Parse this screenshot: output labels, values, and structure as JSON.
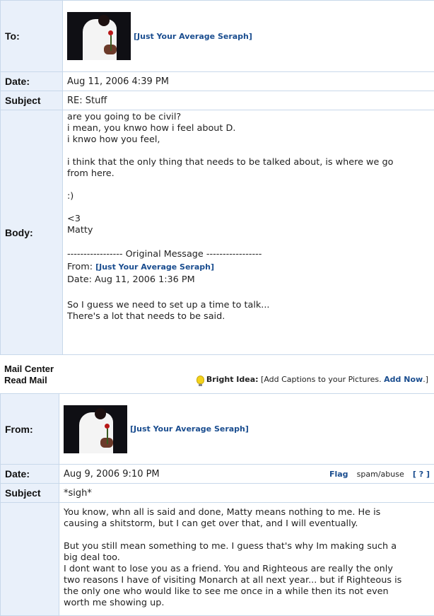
{
  "message1": {
    "to_label": "To:",
    "to_name": "[Just Your Average Seraph]",
    "date_label": "Date:",
    "date_value": "Aug 11, 2006 4:39 PM",
    "subject_label": "Subject",
    "subject_value": "RE: Stuff",
    "body_label": "Body:",
    "body_lines_a": "are you going to be civil?\ni mean, you knwo how i feel about D.\ni knwo how you feel,\n\ni think that the only thing that needs to be talked about, is where we go\nfrom here.\n\n:)\n\n<3\nMatty\n\n",
    "original_header": "----------------- Original Message -----------------",
    "from_prefix": "From: ",
    "from_name": "[Just Your Average Seraph]",
    "orig_date": "Date: Aug 11, 2006 1:36 PM",
    "body_lines_b": "So I guess we need to set up a time to talk...\nThere's a lot that needs to be said."
  },
  "mail_center": {
    "title": "Mail Center",
    "subtitle": "Read Mail",
    "bright_idea_label": "Bright Idea:",
    "bright_idea_text": "[Add Captions to your Pictures.",
    "add_now_label": "Add Now",
    "bright_idea_end": ".]"
  },
  "message2": {
    "from_label": "From:",
    "from_name": "[Just Your Average Seraph]",
    "date_label": "Date:",
    "date_value": "Aug 9, 2006 9:10 PM",
    "flag_label": "Flag",
    "spam_label": "spam/abuse",
    "help_label": "[ ? ]",
    "subject_label": "Subject",
    "subject_value": "*sigh*",
    "body_text": "You know, whn all is said and done, Matty means nothing to me. He is\ncausing a shitstorm, but I can get over that, and I will eventually.\n\nBut you still mean something to me. I guess that's why Im making such a\nbig deal too.\nI dont want to lose you as a friend. You and Righteous are really the only\ntwo reasons I have of visiting Monarch at all next year... but if Righteous is\nthe only one who would like to see me once in a while then its not even\nworth me showing up."
  }
}
